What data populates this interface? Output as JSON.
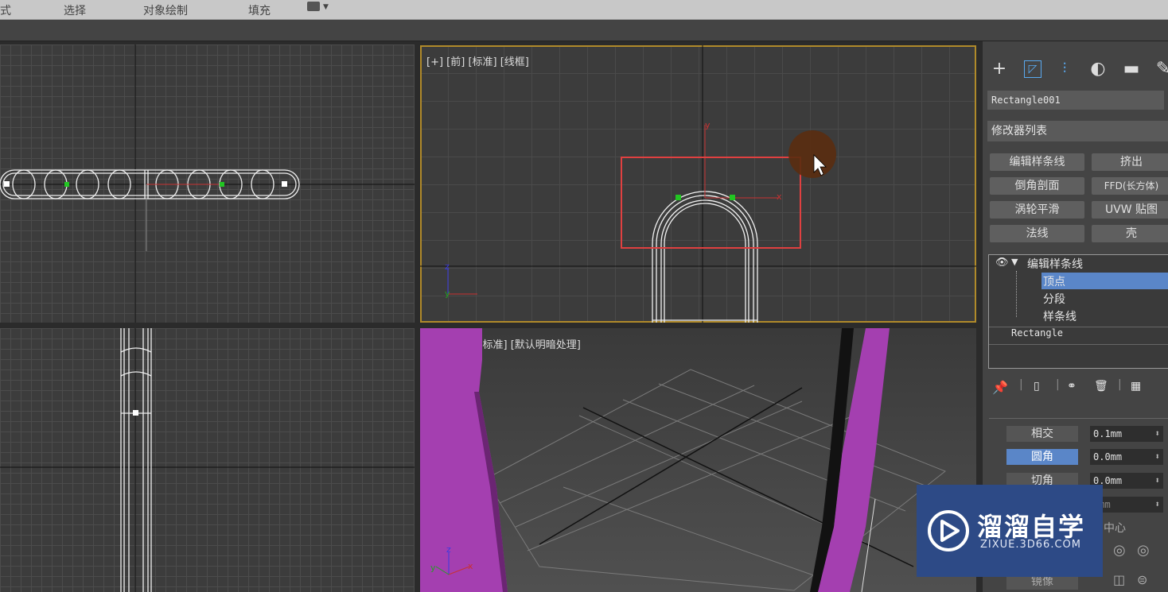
{
  "menubar": {
    "items": [
      "式",
      "选择",
      "对象绘制",
      "填充"
    ]
  },
  "viewports": {
    "top_left": {
      "label": ""
    },
    "front": {
      "label": "[+] [前] [标准] [线框]",
      "axis_y": "y",
      "axis_x": "x",
      "gizmo_z": "z",
      "gizmo_y": "y"
    },
    "bottom_left": {
      "label": ""
    },
    "perspective": {
      "label": "[+] [透视] [标准] [默认明暗处理]",
      "gizmo_z": "z",
      "gizmo_y": "y",
      "gizmo_x": "x"
    }
  },
  "panel": {
    "object_name": "Rectangle001",
    "modifier_list": "修改器列表",
    "modifier_buttons": [
      "编辑样条线",
      "挤出",
      "倒角剖面",
      "FFD(长方体)",
      "涡轮平滑",
      "UVW 贴图",
      "法线",
      "壳"
    ],
    "stack": {
      "top": "编辑样条线",
      "sub": [
        "顶点",
        "分段",
        "样条线"
      ],
      "base": "Rectangle"
    },
    "params": [
      {
        "label": "相交",
        "value": "0.1mm"
      },
      {
        "label": "圆角",
        "value": "0.0mm"
      },
      {
        "label": "切角",
        "value": "0.0mm"
      },
      {
        "label": "",
        "value": "0mm"
      }
    ],
    "center_label": "中心",
    "mirror_label": "镜像"
  },
  "watermark": {
    "brand": "溜溜自学",
    "url": "ZIXUE.3D66.COM"
  }
}
